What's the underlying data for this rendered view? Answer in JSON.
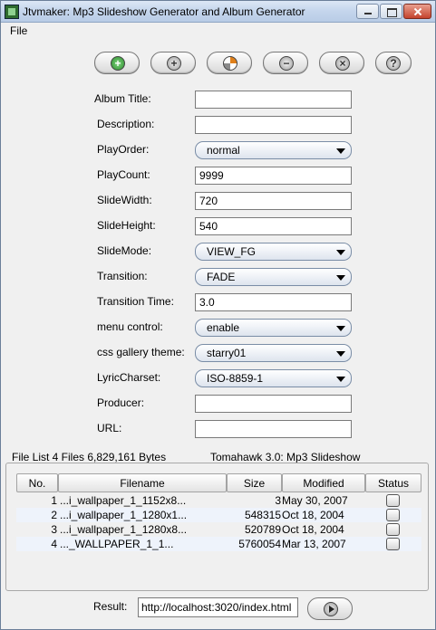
{
  "window": {
    "title": "Jtvmaker: Mp3 Slideshow Generator and Album Generator"
  },
  "menu": {
    "file": "File"
  },
  "toolbar": {
    "buttons": [
      {
        "icon": "add-green-icon",
        "glyph": "+"
      },
      {
        "icon": "add-gray-icon",
        "glyph": "+"
      },
      {
        "icon": "pie-chart-icon",
        "glyph": ""
      },
      {
        "icon": "minus-icon",
        "glyph": "−"
      },
      {
        "icon": "close-x-icon",
        "glyph": "×"
      },
      {
        "icon": "help-icon",
        "glyph": "?"
      }
    ]
  },
  "form": {
    "album_title": {
      "label": "Album Title:",
      "value": ""
    },
    "description": {
      "label": "Description:",
      "value": ""
    },
    "play_order": {
      "label": "PlayOrder:",
      "value": "normal"
    },
    "play_count": {
      "label": "PlayCount:",
      "value": "9999"
    },
    "slide_width": {
      "label": "SlideWidth:",
      "value": "720"
    },
    "slide_height": {
      "label": "SlideHeight:",
      "value": "540"
    },
    "slide_mode": {
      "label": "SlideMode:",
      "value": "VIEW_FG"
    },
    "transition": {
      "label": "Transition:",
      "value": "FADE"
    },
    "transition_time": {
      "label": "Transition Time:",
      "value": "3.0"
    },
    "menu_control": {
      "label": "menu control:",
      "value": "enable"
    },
    "css_theme": {
      "label": "css gallery theme:",
      "value": "starry01"
    },
    "lyric_charset": {
      "label": "LyricCharset:",
      "value": "ISO-8859-1"
    },
    "producer": {
      "label": "Producer:",
      "value": ""
    },
    "url": {
      "label": "URL:",
      "value": ""
    }
  },
  "filelist": {
    "summary": "File List 4 Files 6,829,161 Bytes",
    "title": "Tomahawk 3.0: Mp3 Slideshow",
    "columns": {
      "no": "No.",
      "filename": "Filename",
      "size": "Size",
      "modified": "Modified",
      "status": "Status"
    },
    "rows": [
      {
        "no": "1",
        "filename": "...i_wallpaper_1_1152x8...",
        "size": "3",
        "modified": "May 30, 2007"
      },
      {
        "no": "2",
        "filename": "...i_wallpaper_1_1280x1...",
        "size": "548315",
        "modified": "Oct 18, 2004"
      },
      {
        "no": "3",
        "filename": "...i_wallpaper_1_1280x8...",
        "size": "520789",
        "modified": "Oct 18, 2004"
      },
      {
        "no": "4",
        "filename": "..._WALLPAPER_1_1...",
        "size": "5760054",
        "modified": "Mar 13, 2007"
      }
    ]
  },
  "result": {
    "label": "Result:",
    "value": "http://localhost:3020/index.html"
  }
}
